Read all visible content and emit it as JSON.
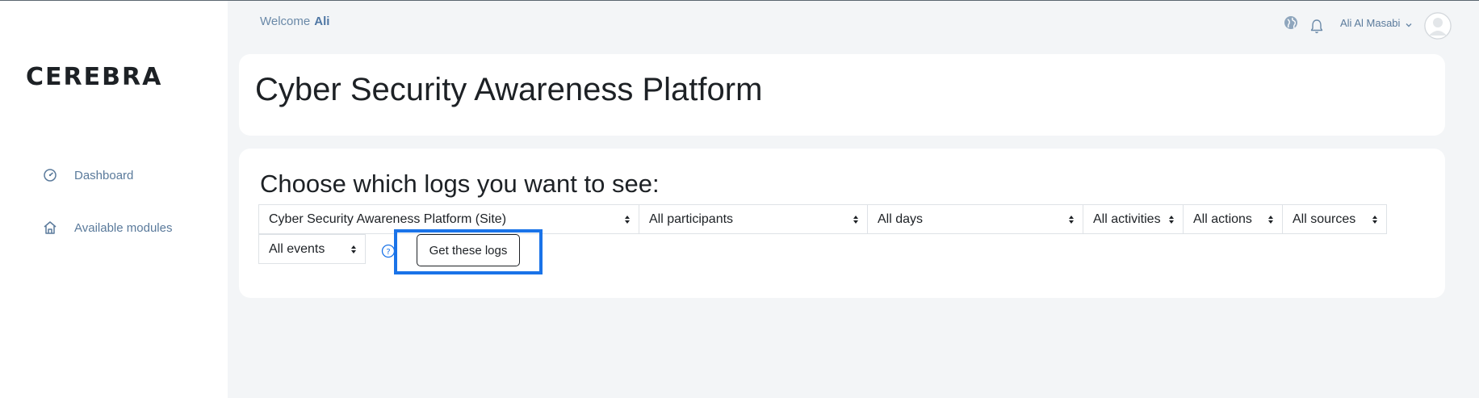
{
  "brand": {
    "name": "CEREBRA"
  },
  "sidebar": {
    "items": [
      {
        "label": "Dashboard",
        "icon": "dashboard-gauge-icon"
      },
      {
        "label": "Available modules",
        "icon": "home-icon"
      }
    ]
  },
  "header": {
    "welcome_prefix": "Welcome",
    "welcome_name": "Ali",
    "user_name": "Ali Al Masabi"
  },
  "page": {
    "title": "Cyber Security Awareness Platform"
  },
  "logs": {
    "heading": "Choose which logs you want to see:",
    "filters": {
      "site": "Cyber Security Awareness Platform (Site)",
      "participants": "All participants",
      "days": "All days",
      "activities": "All activities",
      "actions": "All actions",
      "sources": "All sources",
      "events": "All events"
    },
    "submit_label": "Get these logs"
  },
  "colors": {
    "accent_link": "#5a7a9b",
    "highlight_border": "#1a73e8",
    "page_background": "#f3f5f7"
  }
}
